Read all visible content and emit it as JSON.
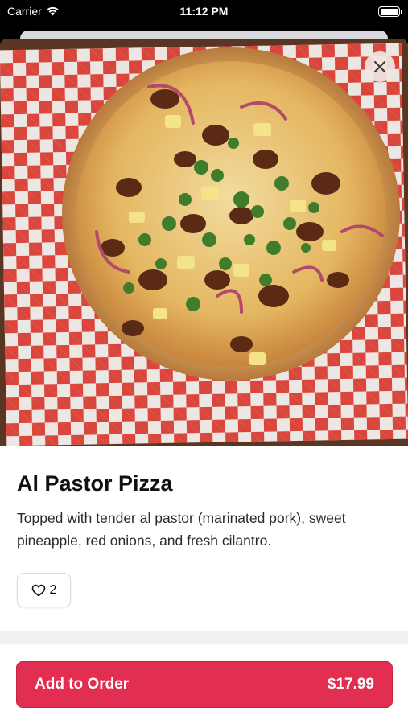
{
  "status_bar": {
    "carrier": "Carrier",
    "time": "11:12 PM"
  },
  "item": {
    "title": "Al Pastor Pizza",
    "description": "Topped with tender al pastor (marinated pork), sweet pineapple, red onions, and fresh cilantro.",
    "likes": "2"
  },
  "footer": {
    "add_label": "Add to Order",
    "price": "$17.99"
  },
  "colors": {
    "accent": "#e22e50",
    "checker_red": "#e2473e"
  },
  "icons": {
    "close": "close-icon",
    "like": "heart-icon",
    "wifi": "wifi-icon",
    "battery": "battery-icon"
  }
}
